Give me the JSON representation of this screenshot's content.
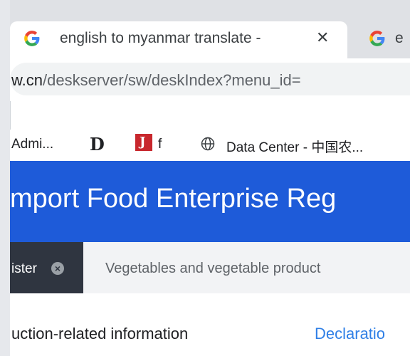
{
  "browser": {
    "active_tab": {
      "title": "english to myanmar translate -",
      "icon": "google-g-icon"
    },
    "next_tab": {
      "title": "e",
      "icon": "google-g-icon"
    },
    "address": {
      "host": "w.cn",
      "path": "/deskserver/sw/deskIndex?menu_id="
    },
    "bookmarks": [
      {
        "label": "Admi..."
      },
      {
        "label": "D",
        "icon": "d-icon"
      },
      {
        "label": "f",
        "icon": "j-logo-icon"
      },
      {
        "label": "Data Center - 中国农...",
        "icon": "globe-icon"
      }
    ]
  },
  "page": {
    "banner_title": "mport Food Enterprise Reg",
    "tabs": [
      {
        "label": "ister",
        "close": "×"
      },
      {
        "label": "Vegetables and vegetable product"
      }
    ],
    "section_title": "uction-related information",
    "section_link": "Declaratio"
  },
  "colors": {
    "banner": "#1e5bd9",
    "dark_tab": "#2f3540",
    "link": "#2f7fe6"
  }
}
